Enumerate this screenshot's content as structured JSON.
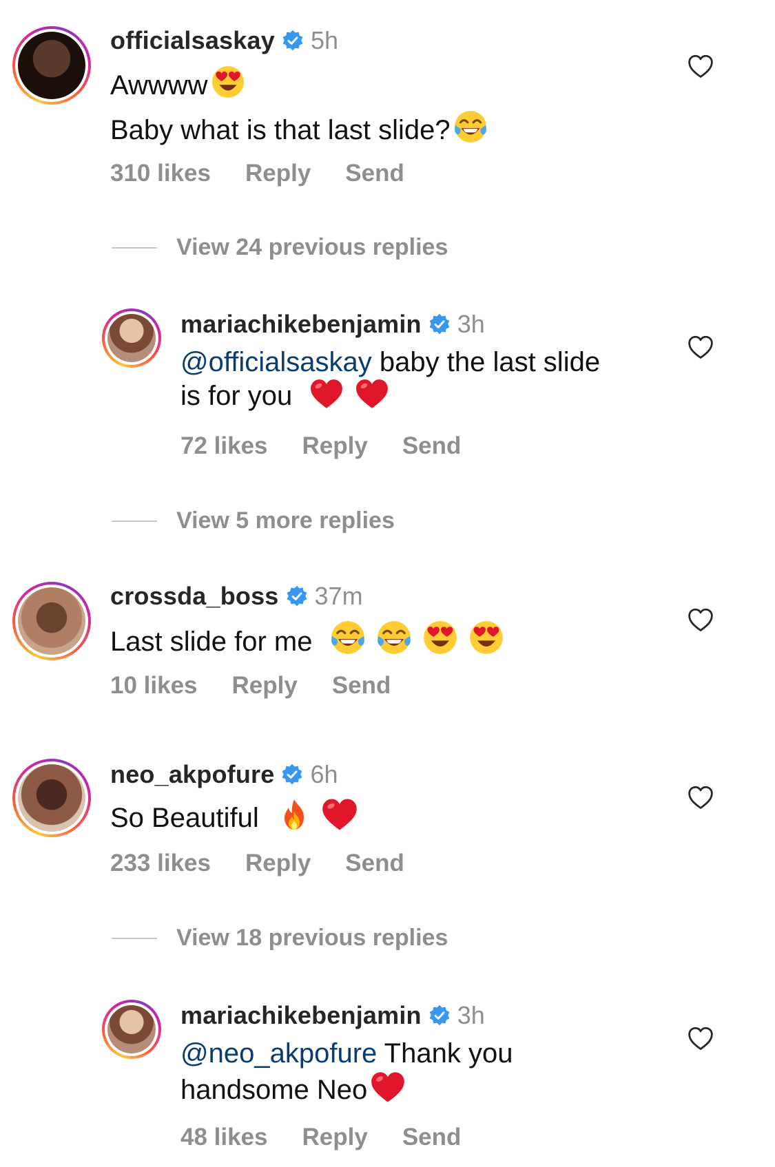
{
  "comments": [
    {
      "username": "officialsaskay",
      "time": "5h",
      "lines": [
        "Awwww",
        "Baby what is that last slide?"
      ],
      "likes": "310 likes",
      "reply": "Reply",
      "send": "Send"
    },
    {
      "username": "mariachikebenjamin",
      "time": "3h",
      "mention": "@officialsaskay",
      "text_rest": " baby the last slide",
      "text_line2": "is for you",
      "likes": "72 likes",
      "reply": "Reply",
      "send": "Send"
    },
    {
      "username": "crossda_boss",
      "time": "37m",
      "text": "Last slide for me",
      "likes": "10 likes",
      "reply": "Reply",
      "send": "Send"
    },
    {
      "username": "neo_akpofure",
      "time": "6h",
      "text": "So Beautiful",
      "likes": "233 likes",
      "reply": "Reply",
      "send": "Send"
    },
    {
      "username": "mariachikebenjamin",
      "time": "3h",
      "mention": "@neo_akpofure",
      "text_rest": " Thank you",
      "text_line2": "handsome Neo",
      "likes": "48 likes",
      "reply": "Reply",
      "send": "Send"
    }
  ],
  "view_replies": [
    "View 24 previous replies",
    "View 5 more replies",
    "View 18 previous replies"
  ],
  "colors": {
    "verified": "#3897f0",
    "mention": "#0b3c6f",
    "muted": "#8e8e8e"
  },
  "icons": [
    "verified-badge-icon",
    "heart-outline-icon",
    "heart-eyes-emoji",
    "tears-of-joy-emoji",
    "red-heart-emoji",
    "fire-emoji"
  ]
}
